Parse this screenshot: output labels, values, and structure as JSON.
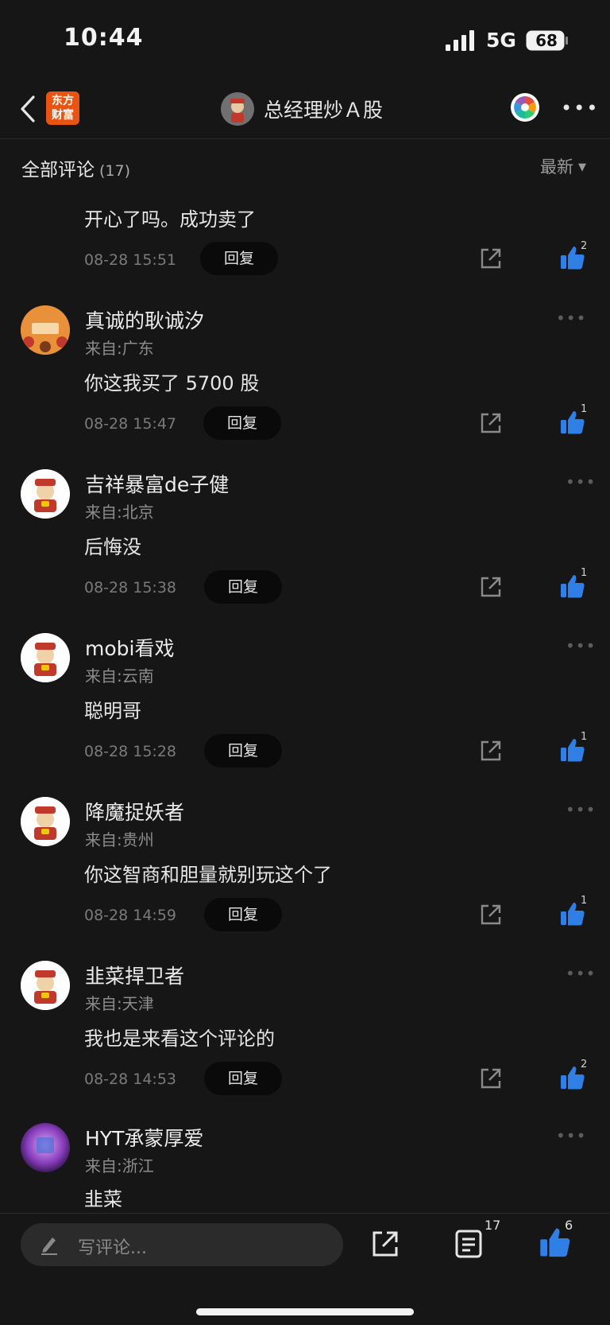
{
  "status_bar": {
    "time": "10:44",
    "network": "5G",
    "battery": "68"
  },
  "navbar": {
    "logo_line1": "东方",
    "logo_line2": "财富",
    "title": "总经理炒Ａ股"
  },
  "section": {
    "title": "全部评论",
    "count": "(17)",
    "sort": "最新"
  },
  "comments": [
    {
      "username": "",
      "location": "",
      "text": "开心了吗。成功卖了",
      "time": "08-28 15:51",
      "reply": "回复",
      "likes": "2",
      "avatar": "none"
    },
    {
      "username": "真诚的耿诚汐",
      "location": "来自:广东",
      "text": "你这我买了 5700 股",
      "time": "08-28 15:47",
      "reply": "回复",
      "likes": "1",
      "avatar": "custom-orange"
    },
    {
      "username": "吉祥暴富de子健",
      "location": "来自:北京",
      "text": "后悔没",
      "time": "08-28 15:38",
      "reply": "回复",
      "likes": "1",
      "avatar": "default"
    },
    {
      "username": "mobi看戏",
      "location": "来自:云南",
      "text": "聪明哥",
      "time": "08-28 15:28",
      "reply": "回复",
      "likes": "1",
      "avatar": "default"
    },
    {
      "username": "降魔捉妖者",
      "location": "来自:贵州",
      "text": "你这智商和胆量就别玩这个了",
      "time": "08-28 14:59",
      "reply": "回复",
      "likes": "1",
      "avatar": "default"
    },
    {
      "username": "韭菜捍卫者",
      "location": "来自:天津",
      "text": "我也是来看这个评论的",
      "time": "08-28 14:53",
      "reply": "回复",
      "likes": "2",
      "avatar": "default"
    },
    {
      "username": "HYT承蒙厚爱",
      "location": "来自:浙江",
      "text": "韭菜",
      "time": "",
      "reply": "",
      "likes": "",
      "avatar": "custom-purple"
    }
  ],
  "bottom_bar": {
    "placeholder": "写评论...",
    "comment_count": "17",
    "like_count": "6"
  },
  "colors": {
    "background": "#161616",
    "like_blue": "#2f7fe6",
    "brand_orange": "#ea5413"
  }
}
